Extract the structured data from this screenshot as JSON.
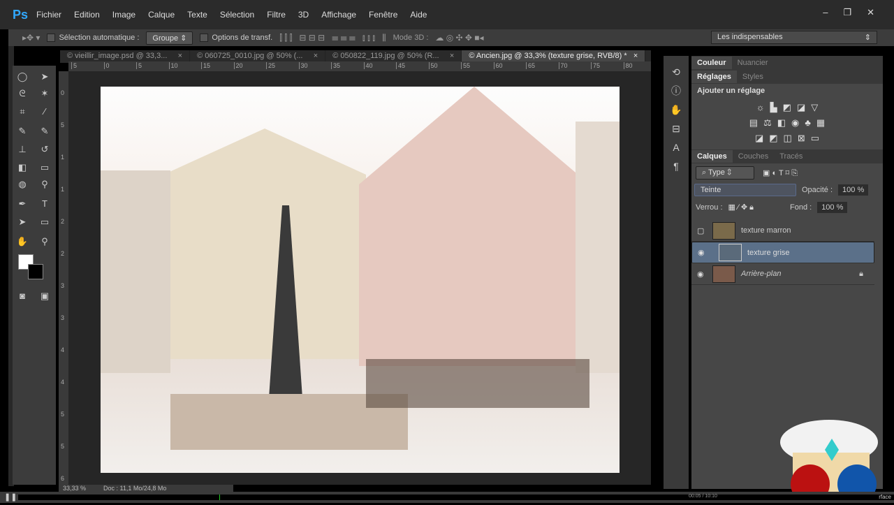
{
  "app": {
    "logo": "Ps",
    "menus": [
      "Fichier",
      "Edition",
      "Image",
      "Calque",
      "Texte",
      "Sélection",
      "Filtre",
      "3D",
      "Affichage",
      "Fenêtre",
      "Aide"
    ],
    "window_controls": [
      "–",
      "❐",
      "✕"
    ]
  },
  "options": {
    "auto_select_label": "Sélection automatique :",
    "auto_select_value": "Groupe",
    "transform_label": "Options de transf.",
    "mode3d_label": "Mode 3D :",
    "workspace": "Les indispensables"
  },
  "tabs": [
    {
      "label": "© vieillir_image.psd @ 33,3...",
      "close": "×"
    },
    {
      "label": "© 060725_0010.jpg @ 50% (...",
      "close": "×"
    },
    {
      "label": "© 050822_119.jpg @ 50% (R...",
      "close": "×"
    },
    {
      "label": "© Ancien.jpg @ 33,3% (texture grise, RVB/8) *",
      "close": "×"
    }
  ],
  "ruler_h": [
    "5",
    "0",
    "5",
    "10",
    "15",
    "20",
    "25",
    "30",
    "35",
    "40",
    "45",
    "50",
    "55",
    "60",
    "65",
    "70",
    "75",
    "80"
  ],
  "ruler_v": [
    "0",
    "5",
    "1",
    "1",
    "2",
    "2",
    "3",
    "3",
    "4",
    "4",
    "5",
    "5",
    "6"
  ],
  "status": {
    "zoom": "33,33 %",
    "doc": "Doc : 11,1 Mo/24,8 Mo"
  },
  "panels": {
    "color_tabs": [
      "Couleur",
      "Nuancier"
    ],
    "adjust_tabs": [
      "Réglages",
      "Styles"
    ],
    "adjust_title": "Ajouter un réglage",
    "layer_tabs": [
      "Calques",
      "Couches",
      "Tracés"
    ],
    "filter_type": "Type",
    "blend_mode": "Teinte",
    "opacity_label": "Opacité :",
    "opacity_value": "100 %",
    "lock_label": "Verrou :",
    "fill_label": "Fond :",
    "fill_value": "100 %",
    "layers": [
      {
        "name": "texture marron",
        "visible": false,
        "selected": false,
        "color": "#7a6a4a"
      },
      {
        "name": "texture grise",
        "visible": true,
        "selected": true,
        "color": "#5a6a7a"
      },
      {
        "name": "Arrière-plan",
        "visible": true,
        "selected": false,
        "locked": true,
        "color": "#7a5a4a"
      }
    ]
  },
  "video": {
    "time": "00:05 / 10:10",
    "progress": 0.23,
    "label": "rface"
  }
}
